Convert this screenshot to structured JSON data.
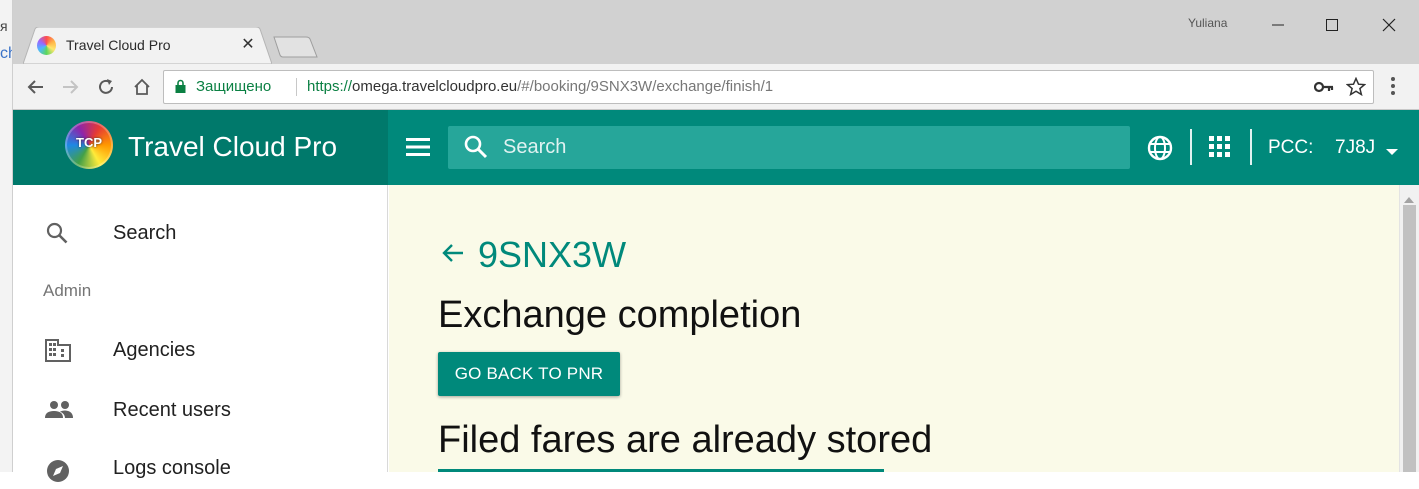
{
  "background_window": {
    "text_top": "я",
    "text_link": "ch"
  },
  "browser": {
    "tab": {
      "title": "Travel Cloud Pro",
      "close_symbol": "✕"
    },
    "window_user": "Yuliana",
    "omnibox": {
      "secure_label": "Защищено",
      "url_scheme": "https://",
      "url_host": "omega.travelcloudpro.eu",
      "url_path": "/#/booking/9SNX3W/exchange/finish/1"
    }
  },
  "header": {
    "brand_logo_text": "TCP",
    "brand_title": "Travel Cloud Pro",
    "search_placeholder": "Search",
    "pcc_label": "PCC:",
    "pcc_value": "7J8J"
  },
  "sidebar": {
    "search_label": "Search",
    "section_title": "Admin",
    "items": [
      {
        "label": "Agencies",
        "icon": "building-icon"
      },
      {
        "label": "Recent users",
        "icon": "users-icon"
      },
      {
        "label": "Logs console",
        "icon": "compass-icon"
      }
    ]
  },
  "main": {
    "pnr": "9SNX3W",
    "page_title": "Exchange completion",
    "go_back_label": "GO BACK TO PNR",
    "section_title": "Filed fares are already stored"
  },
  "colors": {
    "primary": "#00897b",
    "primary_dark": "#00796b",
    "search_bg": "#26a69a",
    "content_bg": "#fafae8",
    "secure_green": "#0b8043"
  }
}
